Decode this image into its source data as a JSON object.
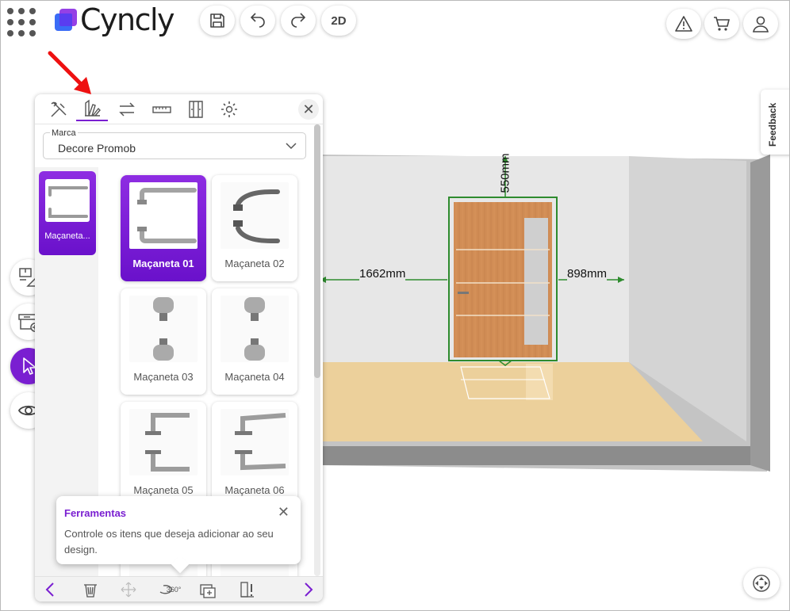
{
  "app": {
    "brand": "Cyncly"
  },
  "toolbar": {
    "view_mode_label": "2D",
    "save_icon": "save-icon",
    "undo_icon": "undo-icon",
    "redo_icon": "redo-icon",
    "warning_icon": "warning-icon",
    "cart_icon": "cart-icon",
    "user_icon": "user-icon"
  },
  "viewport": {
    "dim_top": "550mm",
    "dim_left": "1662mm",
    "dim_right": "898mm",
    "colors": {
      "dimension": "#2e8b2e",
      "wall": "#e3e3e3",
      "floor": "#e8c991"
    }
  },
  "panel": {
    "tabs": [
      "tools-icon",
      "catalog-icon",
      "swap-icon",
      "ruler-icon",
      "door-icon",
      "settings-icon"
    ],
    "active_tab": "catalog-icon",
    "brand_select": {
      "label": "Marca",
      "value": "Decore Promob"
    },
    "category": {
      "label": "Maçaneta..."
    },
    "items": [
      {
        "label": "Maçaneta 01",
        "selected": true
      },
      {
        "label": "Maçaneta 02",
        "selected": false
      },
      {
        "label": "Maçaneta 03",
        "selected": false
      },
      {
        "label": "Maçaneta 04",
        "selected": false
      },
      {
        "label": "Maçaneta 05",
        "selected": false
      },
      {
        "label": "Maçaneta 06",
        "selected": false
      }
    ],
    "footer": {
      "rotate_label": "360°"
    }
  },
  "tooltip": {
    "title": "Ferramentas",
    "text": "Controle os itens que deseja adicionar ao seu design."
  },
  "feedback": {
    "label": "Feedback"
  },
  "accent": "#7a1fd1"
}
